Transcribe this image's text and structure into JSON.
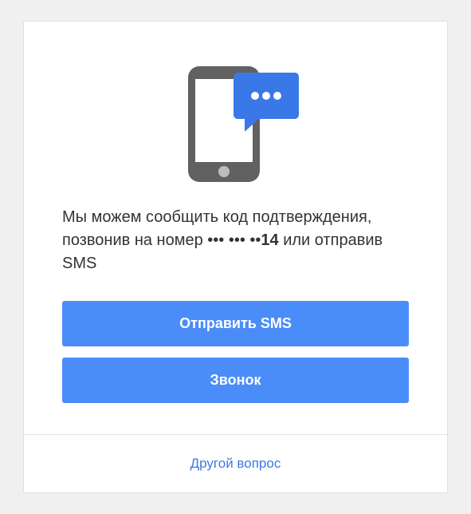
{
  "description": {
    "prefix": "Мы можем сообщить код подтверждения, позвонив на номер ",
    "masked": "••• ••• ••",
    "visible_digits": "14",
    "suffix": " или отправив SMS"
  },
  "buttons": {
    "send_sms": "Отправить SMS",
    "call": "Звонок"
  },
  "footer": {
    "other_question": "Другой вопрос"
  }
}
